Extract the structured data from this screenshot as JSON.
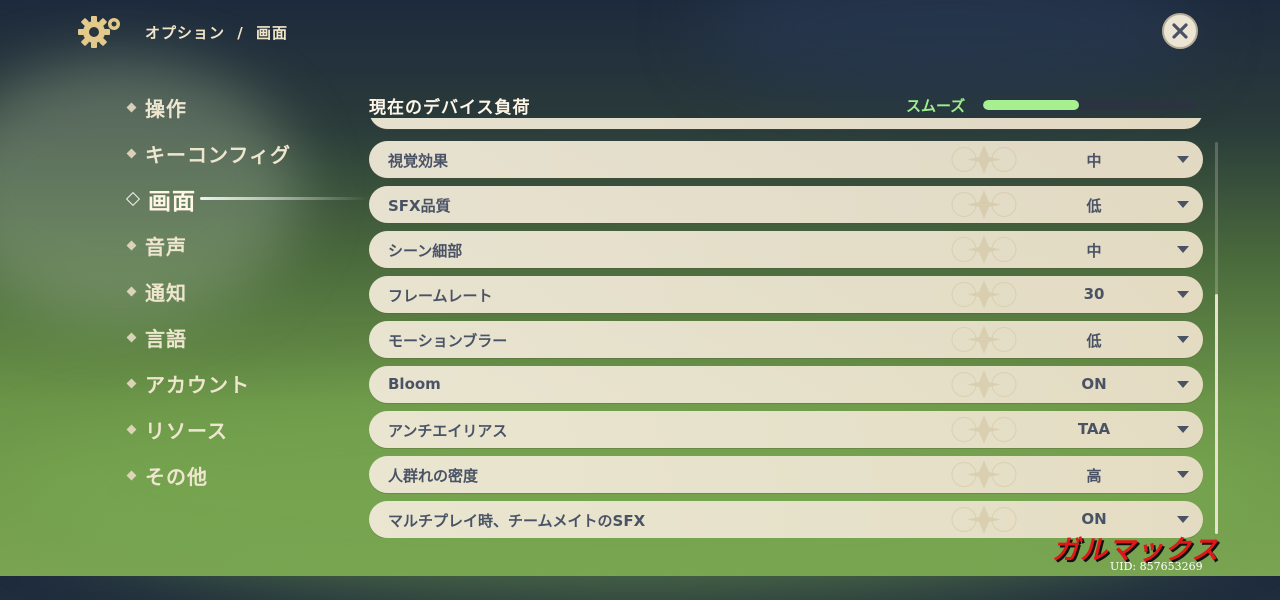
{
  "header": {
    "breadcrumb_parent": "オプション",
    "breadcrumb_sep": "/",
    "breadcrumb_current": "画面"
  },
  "sidebar": {
    "items": [
      {
        "label": "操作",
        "active": false
      },
      {
        "label": "キーコンフィグ",
        "active": false
      },
      {
        "label": "画面",
        "active": true
      },
      {
        "label": "音声",
        "active": false
      },
      {
        "label": "通知",
        "active": false
      },
      {
        "label": "言語",
        "active": false
      },
      {
        "label": "アカウント",
        "active": false
      },
      {
        "label": "リソース",
        "active": false
      },
      {
        "label": "その他",
        "active": false
      }
    ]
  },
  "device_load": {
    "title": "現在のデバイス負荷",
    "status": "スムーズ",
    "level": 0.45,
    "status_color": "#9ff08a"
  },
  "settings": [
    {
      "label": "視覚効果",
      "value": "中"
    },
    {
      "label": "SFX品質",
      "value": "低"
    },
    {
      "label": "シーン細部",
      "value": "中"
    },
    {
      "label": "フレームレート",
      "value": "30"
    },
    {
      "label": "モーションブラー",
      "value": "低"
    },
    {
      "label": "Bloom",
      "value": "ON"
    },
    {
      "label": "アンチエイリアス",
      "value": "TAA"
    },
    {
      "label": "人群れの密度",
      "value": "高"
    },
    {
      "label": "マルチプレイ時、チームメイトのSFX",
      "value": "ON"
    }
  ],
  "watermark": {
    "logo_text": "ガルマックス",
    "uid": "UID: 857653269"
  },
  "colors": {
    "panel": "#ece4d0",
    "text_dark": "#4a5366",
    "text_light": "#f2e6c8"
  }
}
